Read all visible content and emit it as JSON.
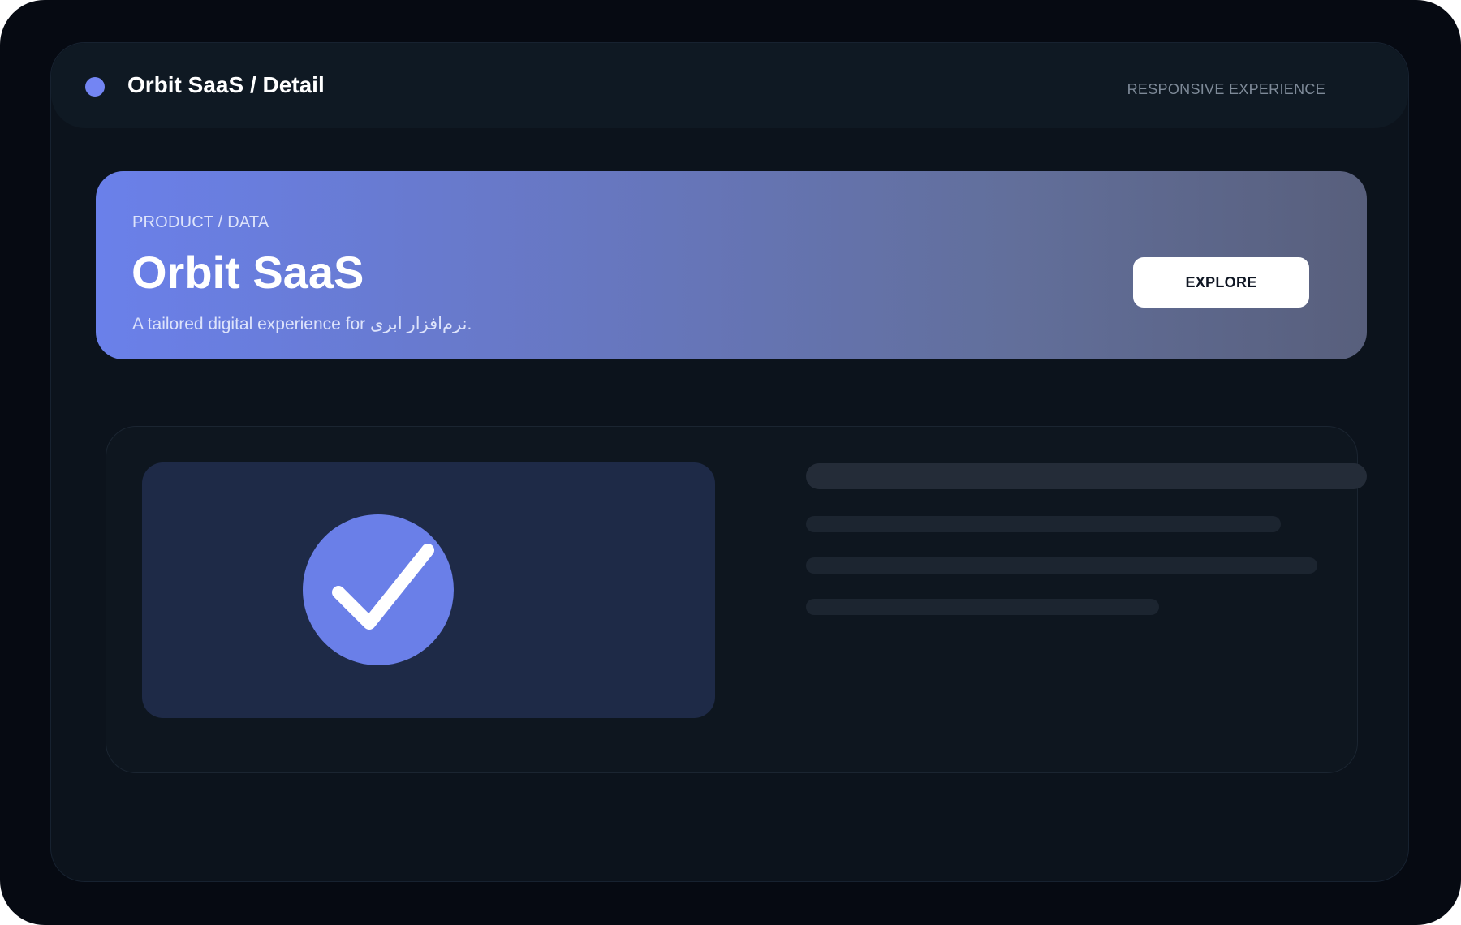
{
  "header": {
    "title": "Orbit SaaS / Detail",
    "tag": "RESPONSIVE EXPERIENCE"
  },
  "hero": {
    "eyebrow": "PRODUCT / DATA",
    "title": "Orbit SaaS",
    "subtitle": "A tailored digital experience for نرم‌افزار ابری.",
    "cta_label": "EXPLORE"
  },
  "icons": {
    "status": "status-dot-icon",
    "media": "checkmark-icon"
  },
  "colors": {
    "accent": "#6a7fe8",
    "background": "#0c131c",
    "button": "#ffffff"
  }
}
